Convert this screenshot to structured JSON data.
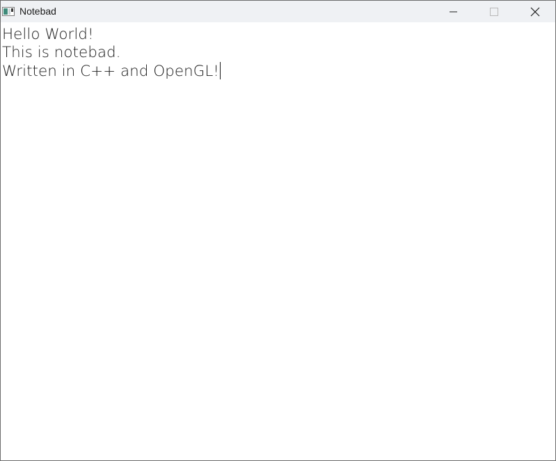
{
  "window": {
    "title": "Notebad",
    "icon": "app-window-icon",
    "controls": {
      "minimize_icon": "minimize-icon",
      "maximize_icon": "maximize-icon",
      "close_icon": "close-icon"
    }
  },
  "editor": {
    "lines": [
      "Hello World!",
      "This is notebad.",
      "Written in C++ and OpenGL!"
    ],
    "caret_position": "end-of-line-3"
  },
  "colors": {
    "titlebar_background": "#eff1f4",
    "editor_background": "#ffffff",
    "text": "#1c1c1c"
  }
}
